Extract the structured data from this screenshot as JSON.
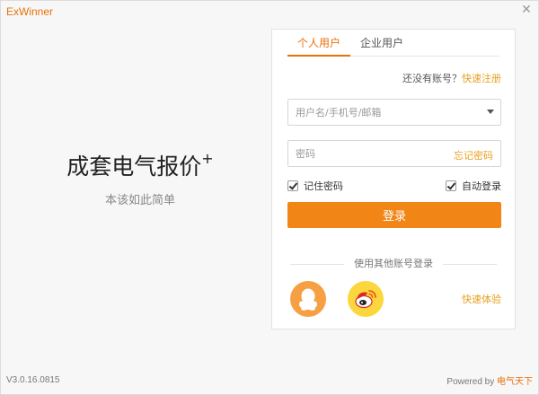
{
  "window": {
    "title": "ExWinner",
    "close_icon": "close-icon"
  },
  "hero": {
    "title": "成套电气报价",
    "title_sup": "+",
    "subtitle": "本该如此简单"
  },
  "login": {
    "tabs": [
      {
        "label": "个人用户",
        "active": true
      },
      {
        "label": "企业用户",
        "active": false
      }
    ],
    "register_prompt": "还没有账号？",
    "register_link": "快速注册",
    "username_placeholder": "用户名/手机号/邮箱",
    "password_placeholder": "密码",
    "forgot_password": "忘记密码",
    "remember_label": "记住密码",
    "remember_checked": true,
    "auto_login_label": "自动登录",
    "auto_login_checked": true,
    "login_button": "登录",
    "other_login": "使用其他账号登录",
    "social": [
      "qq-icon",
      "weibo-icon"
    ],
    "quick_try": "快速体验"
  },
  "footer": {
    "version": "V3.0.16.0815",
    "powered_by": "Powered by",
    "brand": "电气天下"
  },
  "colors": {
    "accent": "#f18617",
    "link": "#e8a020",
    "qq": "#f6a043",
    "weibo": "#fcd63d"
  }
}
